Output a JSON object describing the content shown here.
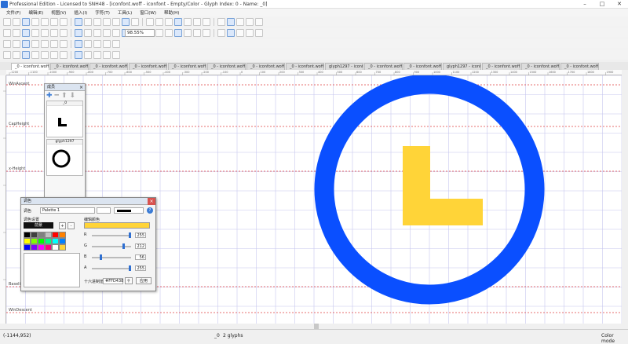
{
  "window": {
    "title": "Professional Edition - Licensed to SNH48 - [iconfont.woff - iconfont - Empty/Color - Glyph Index: 0 - Name: _0]",
    "controls": [
      "–",
      "□",
      "✕"
    ]
  },
  "menu": [
    "文件(F)",
    "编辑(E)",
    "视图(V)",
    "插入(I)",
    "字符(T)",
    "工具(L)",
    "窗口(W)",
    "帮助(H)"
  ],
  "toolbar": {
    "zoom_value": "98.55%"
  },
  "tabs": [
    "_0 - iconfont.woff",
    "_0 - iconfont.woff",
    "_0 - iconfont.woff",
    "_0 - iconfont.woff",
    "_0 - iconfont.woff",
    "_0 - iconfont.woff",
    "_0 - iconfont.woff",
    "_0 - iconfont.woff",
    "glyph1297 - iconfont.woff",
    "_0 - iconfont.woff",
    "_0 - iconfont.woff",
    "glyph1297 - iconfont.woff",
    "_0 - iconfont.woff",
    "_0 - iconfont.woff",
    "_0 - iconfont.woff"
  ],
  "ruler_ticks": [
    "-1200",
    "-1100",
    "-1000",
    "-900",
    "-800",
    "-700",
    "-600",
    "-500",
    "-400",
    "-300",
    "-200",
    "-100",
    "0",
    "100",
    "200",
    "300",
    "400",
    "500",
    "600",
    "700",
    "800",
    "900",
    "1000",
    "1100",
    "1200",
    "1300",
    "1400",
    "1500",
    "1600",
    "1700",
    "1800",
    "1900",
    "2000"
  ],
  "guides": {
    "win_ascent": "WinAscent",
    "cap_height": "CapHeight",
    "x_height": "x-Height",
    "baseline": "Baseline",
    "win_descent": "WinDescent"
  },
  "glyph_panel": {
    "title": "成员",
    "items": [
      {
        "name": "_0"
      },
      {
        "name": "glyph1297"
      }
    ]
  },
  "color_dialog": {
    "title": "调色",
    "palette_label": "调色",
    "palette_value": "Palette 1",
    "palette_settings_label": "调色设置",
    "selected_swatch_label": "前景",
    "edit_color_label": "编辑颜色",
    "channels": [
      {
        "label": "R",
        "value": "255",
        "level": 1.0
      },
      {
        "label": "G",
        "value": "212",
        "level": 0.831
      },
      {
        "label": "B",
        "value": "56",
        "level": 0.22
      },
      {
        "label": "A",
        "value": "255",
        "level": 1.0
      }
    ],
    "hex_label": "十六进制值",
    "hex_value": "#FFD438",
    "apply_label": "应用",
    "add_label": "+",
    "remove_label": "-",
    "swatches": [
      "#000000",
      "#404040",
      "#808080",
      "#c0c0c0",
      "#ff0000",
      "#ff8000",
      "#ffff00",
      "#80ff00",
      "#00ff00",
      "#00ff80",
      "#00ffff",
      "#0080ff",
      "#0000ff",
      "#8000ff",
      "#ff00ff",
      "#ff0080",
      "#ffffff",
      "#ffd438"
    ]
  },
  "colors": {
    "ring": "#0a4fff",
    "glyph": "#ffd438",
    "guide": "#e04040",
    "grid": "#c6c6ee"
  },
  "status": {
    "coords": "(-1144,952)",
    "selection": "_0",
    "glyph_count": "2 glyphs",
    "mode": "Color mode"
  }
}
